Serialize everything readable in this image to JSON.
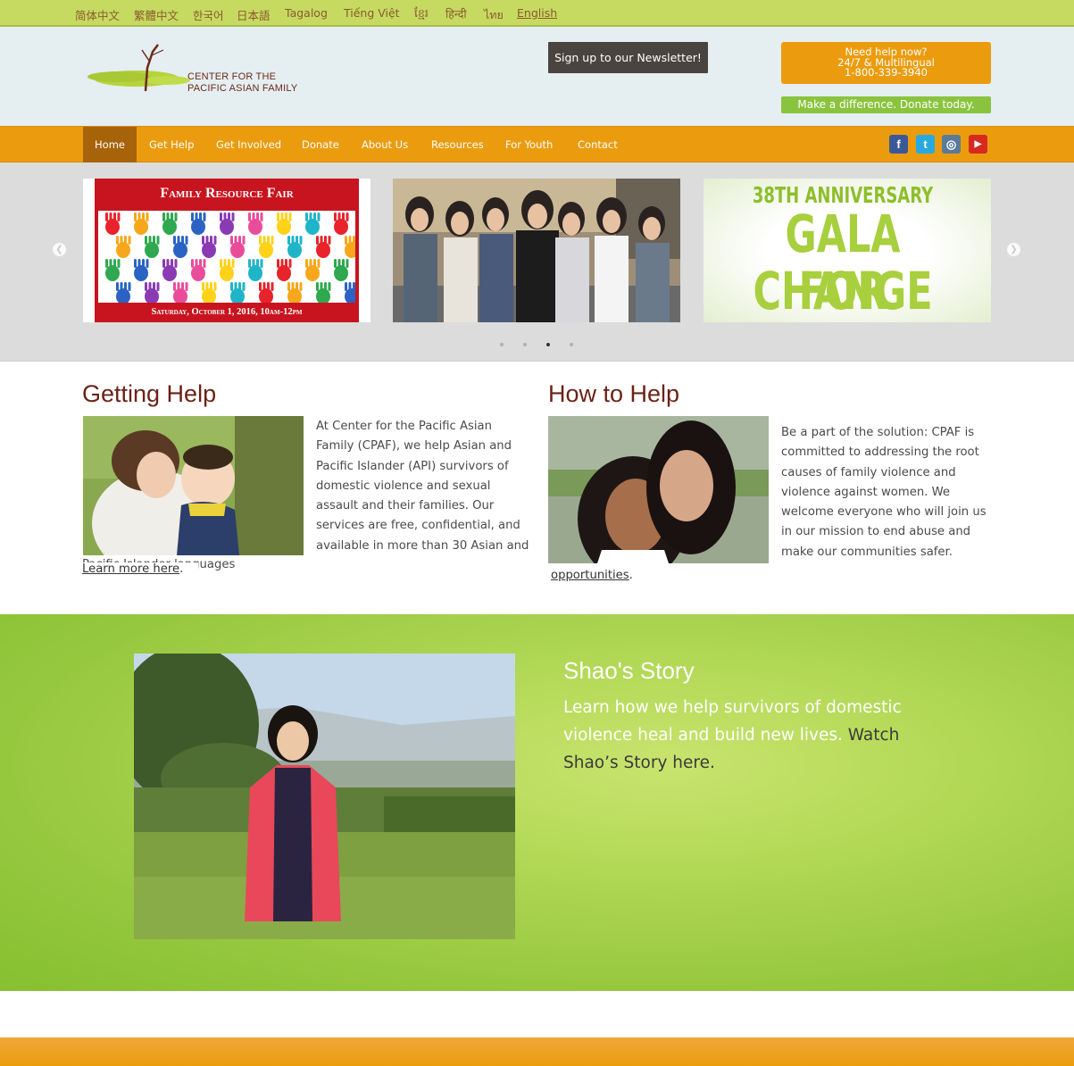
{
  "languages": [
    {
      "label": "简体中文"
    },
    {
      "label": "繁體中文"
    },
    {
      "label": "한국어"
    },
    {
      "label": "日本語"
    },
    {
      "label": "Tagalog"
    },
    {
      "label": "Tiếng Việt"
    },
    {
      "label": "ខ្មែរ"
    },
    {
      "label": "हिन्दी"
    },
    {
      "label": "ไทย"
    },
    {
      "label": "English"
    }
  ],
  "logo": {
    "line1": "CENTER FOR THE",
    "line2": "PACIFIC ASIAN FAMILY"
  },
  "newsletter_label": "Sign up to our Newsletter!",
  "helpline": {
    "line1": "Need help now?",
    "line2": "24/7 & Multilingual",
    "line3": "1-800-339-3940"
  },
  "donate_label": "Make a difference. Donate today.",
  "nav": [
    {
      "label": "Home"
    },
    {
      "label": "Get Help"
    },
    {
      "label": "Get Involved"
    },
    {
      "label": "Donate"
    },
    {
      "label": "About Us"
    },
    {
      "label": "Resources"
    },
    {
      "label": "For Youth"
    },
    {
      "label": "Contact"
    }
  ],
  "social": [
    {
      "icon": "facebook-icon",
      "glyph": "f",
      "color": "#3b5998"
    },
    {
      "icon": "twitter-icon",
      "glyph": "t",
      "color": "#29a9e1"
    },
    {
      "icon": "instagram-icon",
      "glyph": "◎",
      "color": "#5a7a9a"
    },
    {
      "icon": "youtube-icon",
      "glyph": "▶",
      "color": "#d62a1e"
    }
  ],
  "slider": {
    "fair": {
      "title": "Family Resource Fair",
      "date": "Saturday, October 1, 2016, 10am-12pm"
    },
    "gala": {
      "line1": "38TH ANNIVERSARY",
      "line2": "GALA FOR",
      "line3": "CHANGE"
    }
  },
  "getting_help": {
    "title": "Getting Help",
    "text": "At Center for the Pacific Asian Family (CPAF), we help Asian and Pacific Islander (API) survivors of domestic violence and sexual assault and their families.  Our services are free, confidential, and available in more than 30 Asian and",
    "overflow": "Pacific Islander languages",
    "link": "Learn more here"
  },
  "how_to_help": {
    "title": "How to Help",
    "text": "Be a part of the solution: CPAF is committed to addressing the root causes of family violence and violence against women. We welcome everyone who will join us in our mission to end abuse and make our communities safer.",
    "link": "opportunities"
  },
  "story": {
    "title": "Shao's Story",
    "text": "Learn how we help survivors of domestic violence heal and build new lives.",
    "cta": "Watch Shao’s Story here."
  },
  "colors": {
    "lang_bar": "#c6da62",
    "nav": "#eb9c0e",
    "nav_active": "#a7630a",
    "heading": "#6b2216",
    "story_green": "#96c83e"
  }
}
